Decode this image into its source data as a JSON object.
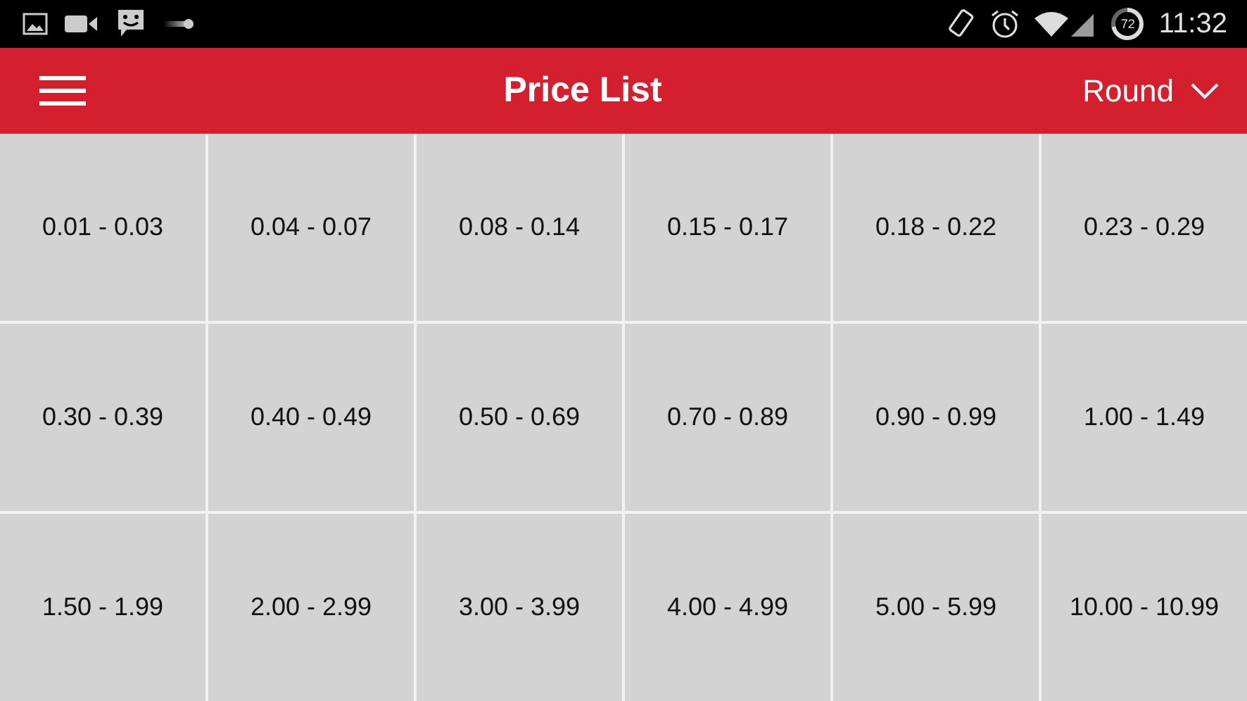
{
  "status_bar": {
    "battery": "72",
    "time": "11:32"
  },
  "toolbar": {
    "title": "Price List",
    "dropdown": "Round"
  },
  "price_ranges": [
    "0.01 - 0.03",
    "0.04 - 0.07",
    "0.08 - 0.14",
    "0.15 - 0.17",
    "0.18 - 0.22",
    "0.23 - 0.29",
    "0.30 - 0.39",
    "0.40 - 0.49",
    "0.50 - 0.69",
    "0.70 - 0.89",
    "0.90 - 0.99",
    "1.00 - 1.49",
    "1.50 - 1.99",
    "2.00 - 2.99",
    "3.00 - 3.99",
    "4.00 - 4.99",
    "5.00 - 5.99",
    "10.00 - 10.99"
  ]
}
